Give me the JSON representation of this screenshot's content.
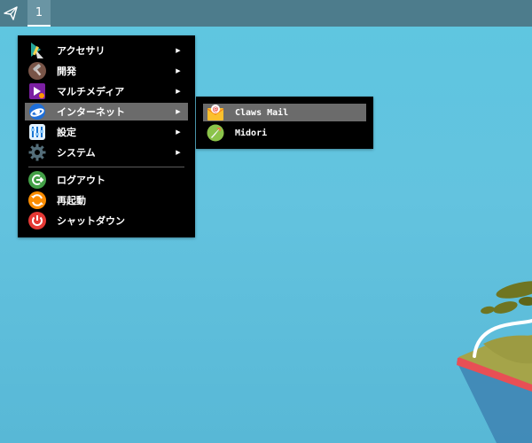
{
  "taskbar": {
    "menu_icon": "paper-plane-icon",
    "workspace_label": "1"
  },
  "main_menu": {
    "items": [
      {
        "label": "アクセサリ",
        "icon": "accessories-icon",
        "submenu": true
      },
      {
        "label": "開発",
        "icon": "development-icon",
        "submenu": true
      },
      {
        "label": "マルチメディア",
        "icon": "multimedia-icon",
        "submenu": true
      },
      {
        "label": "インターネット",
        "icon": "internet-icon",
        "submenu": true,
        "selected": true
      },
      {
        "label": "設定",
        "icon": "settings-icon",
        "submenu": true
      },
      {
        "label": "システム",
        "icon": "system-icon",
        "submenu": true
      },
      {
        "label": "ログアウト",
        "icon": "logout-icon",
        "submenu": false
      },
      {
        "label": "再起動",
        "icon": "reboot-icon",
        "submenu": false
      },
      {
        "label": "シャットダウン",
        "icon": "shutdown-icon",
        "submenu": false
      }
    ],
    "submenu_arrow": "▶"
  },
  "sub_menu": {
    "items": [
      {
        "label": "Claws Mail",
        "icon": "claws-mail-icon",
        "selected": true
      },
      {
        "label": "Midori",
        "icon": "midori-icon",
        "selected": false
      }
    ]
  },
  "colors": {
    "desktop": "#5ec6e0",
    "taskbar": "#4d7c8c",
    "menu_background": "#000000",
    "selection": "#6b6b6b"
  }
}
